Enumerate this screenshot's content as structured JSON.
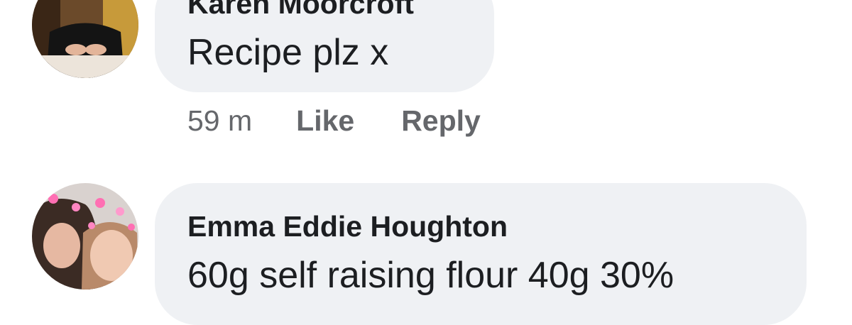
{
  "comments": [
    {
      "author": "Karen Moorcroft",
      "text": "Recipe plz x",
      "time": "59 m",
      "like_label": "Like",
      "reply_label": "Reply"
    },
    {
      "author": "Emma Eddie Houghton",
      "text": "60g self raising flour 40g 30%"
    }
  ],
  "colors": {
    "bubble": "#eff1f4",
    "text": "#1c1e21",
    "meta": "#65676b",
    "accent": "#1877f2"
  }
}
